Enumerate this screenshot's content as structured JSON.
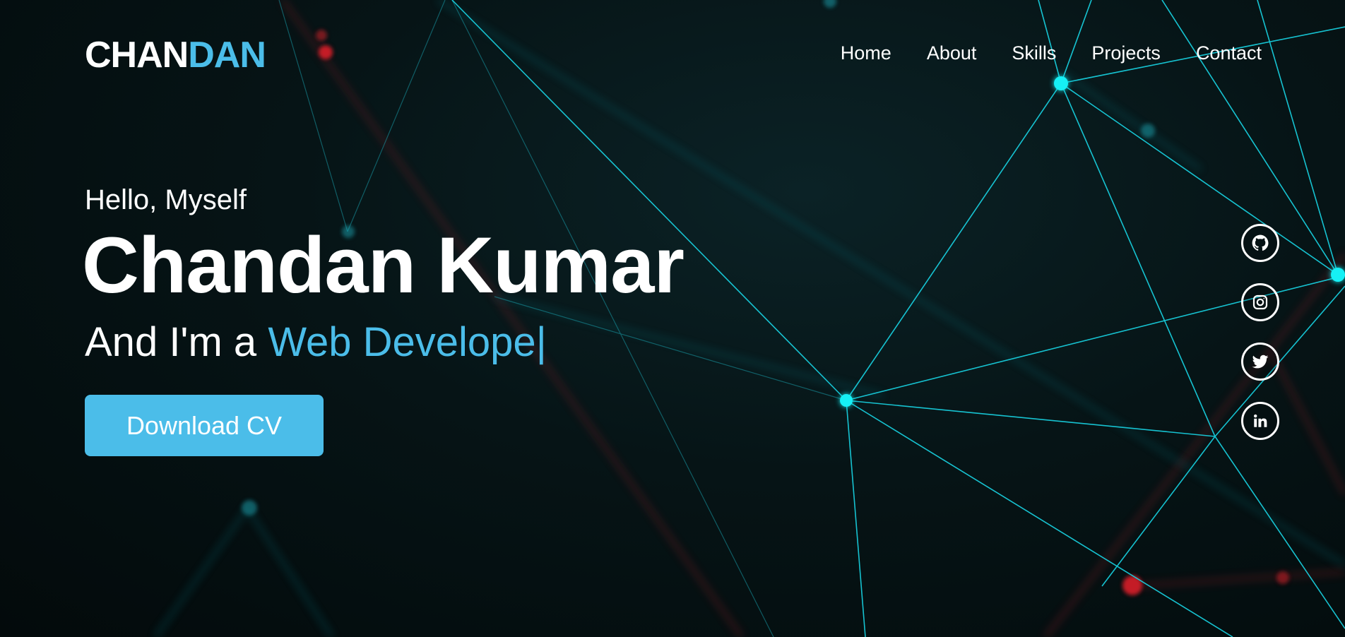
{
  "logo": {
    "part1": "CHAN",
    "part2": "DAN"
  },
  "nav": [
    {
      "label": "Home"
    },
    {
      "label": "About"
    },
    {
      "label": "Skills"
    },
    {
      "label": "Projects"
    },
    {
      "label": "Contact"
    }
  ],
  "hero": {
    "greeting": "Hello, Myself",
    "name": "Chandan Kumar",
    "role_prefix": "And I'm a ",
    "role_typed": "Web Develope",
    "cursor": "|",
    "button_label": "Download CV"
  },
  "socials": [
    {
      "icon": "github-icon"
    },
    {
      "icon": "instagram-icon"
    },
    {
      "icon": "twitter-icon"
    },
    {
      "icon": "linkedin-icon"
    }
  ],
  "colors": {
    "accent": "#4bbde9",
    "network_line": "#19d6e6",
    "network_node": "#12f0f5",
    "red_glow": "#e0242c"
  }
}
